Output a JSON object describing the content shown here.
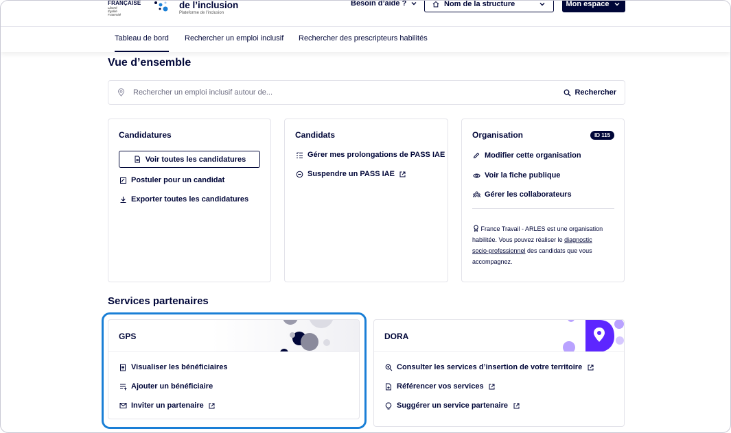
{
  "header": {
    "rf_label": "FRANÇAISE",
    "rf_motto": [
      "Liberté",
      "Égalité",
      "Fraternité"
    ],
    "brand_title": "de l’inclusion",
    "brand_sub": "Plateforme de l’inclusion",
    "help_label": "Besoin d’aide ?",
    "structure_label": "Nom de la structure",
    "space_label": "Mon espace"
  },
  "nav": {
    "items": [
      "Tableau de bord",
      "Rechercher un emploi inclusif",
      "Rechercher des prescripteurs habilités"
    ]
  },
  "page": {
    "title": "Vue d’ensemble",
    "search_placeholder": "Rechercher un emploi inclusif autour de...",
    "search_button": "Rechercher"
  },
  "cards": {
    "candidatures": {
      "title": "Candidatures",
      "view_all": "Voir toutes les candidatures",
      "apply": "Postuler pour un candidat",
      "export": "Exporter toutes les candidatures"
    },
    "candidats": {
      "title": "Candidats",
      "prolongations": "Gérer mes prolongations de PASS IAE",
      "suspend": "Suspendre un PASS IAE"
    },
    "organisation": {
      "title": "Organisation",
      "badge": "ID 115",
      "edit": "Modifier cette organisation",
      "public": "Voir la fiche publique",
      "collaborators": "Gérer les collaborateurs",
      "info_1": "France Travail - ARLES est une organisation",
      "info_2a": "habilitée. Vous pouvez réaliser le ",
      "info_2b": "diagnostic",
      "info_3a": "socio-professionnel",
      "info_3b": " des candidats que vous",
      "info_4": "accompagnez."
    }
  },
  "services": {
    "title": "Services partenaires",
    "gps": {
      "title": "GPS",
      "links": [
        "Visualiser les bénéficiaires",
        "Ajouter un bénéficiaire",
        "Inviter un partenaire"
      ]
    },
    "dora": {
      "title": "DORA",
      "links": [
        "Consulter les services d’insertion de votre territoire",
        "Référencer vos services",
        "Suggérer un service partenaire"
      ]
    }
  },
  "colors": {
    "primary": "#000638",
    "highlight": "#1a7fd6",
    "dora_purple": "#5d26ff"
  }
}
